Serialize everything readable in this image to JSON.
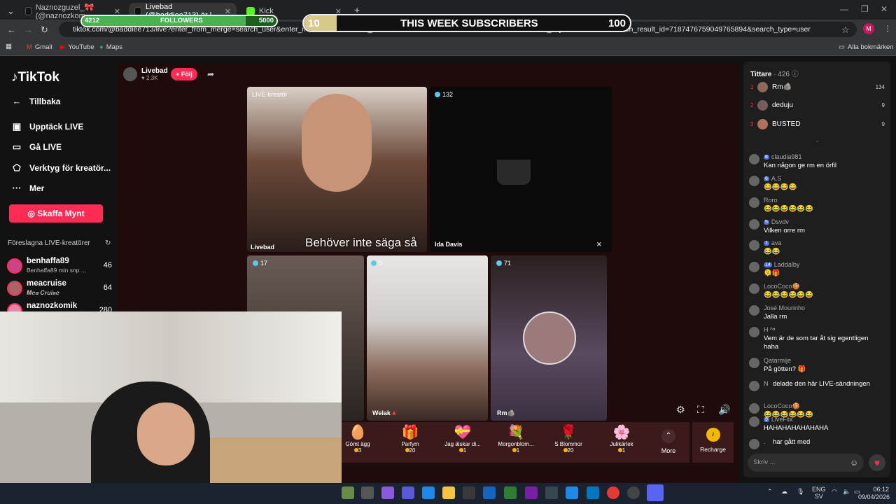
{
  "browser": {
    "tabs": [
      {
        "title": "Naznozguzel_🎀 (@naznozkom"
      },
      {
        "title": "Livebad (@baddiee713) är l"
      },
      {
        "title": "Kick"
      }
    ],
    "url": "tiktok.com/@baddiee713/live?enter_from_merge=search_user&enter_method=o",
    "url_tail": "to&search_id=20260408205018162D1891381717DA076&search_keyword=livebad&search_result_id=7187476759049765894&search_type=user",
    "profile_initial": "M",
    "bookmarks": [
      "Gmail",
      "YouTube",
      "Maps"
    ],
    "all_bookmarks": "Alla bokmärken"
  },
  "overlay": {
    "followers_current": "4212",
    "followers_label": "FOLLOWERS",
    "followers_goal": "5000",
    "followers_progress": 0.84,
    "subs_current": "10",
    "subs_label": "THIS WEEK SUBSCRIBERS",
    "subs_goal": "100",
    "subs_progress": 0.1
  },
  "sidebar": {
    "logo": "TikTok",
    "back": "Tillbaka",
    "items": [
      {
        "label": "Upptäck LIVE",
        "icon": "live-icon"
      },
      {
        "label": "Gå LIVE",
        "icon": "camera-icon"
      },
      {
        "label": "Verktyg för kreatör...",
        "icon": "tools-icon"
      },
      {
        "label": "Mer",
        "icon": "more-icon"
      }
    ],
    "coins_button": "Skaffa Mynt",
    "suggested_title": "Föreslagna LIVE-kreatörer",
    "suggested": [
      {
        "name": "benhaffa89",
        "sub": "Benhaffa89 min snp ...",
        "count": "46"
      },
      {
        "name": "meacruise",
        "sub": "𝑴𝒆𝒂 𝑪𝒓𝒖𝒊𝒔𝒆",
        "count": "64"
      },
      {
        "name": "naznozkomik",
        "sub": "",
        "count": "280"
      }
    ]
  },
  "host": {
    "name": "Livebad",
    "likes": "2.3K",
    "follow": "+ Följ"
  },
  "tiles": [
    {
      "badge": "LIVE-kreatör",
      "name": "Livebad"
    },
    {
      "badge": "132",
      "name": "Ida Davis"
    },
    {
      "badge": "17",
      "name": ""
    },
    {
      "badge": "5",
      "name": "Welak🔺"
    },
    {
      "badge": "71",
      "name": "Rm🪨"
    }
  ],
  "caption": "Behöver inte säga så",
  "gifts": [
    {
      "name": "Gömt ägg",
      "price": "3",
      "icon": "🥚"
    },
    {
      "name": "Parfym",
      "price": "20",
      "icon": "🎁"
    },
    {
      "name": "Jag älskar di...",
      "price": "1",
      "icon": "💝"
    },
    {
      "name": "Morgonblom...",
      "price": "1",
      "icon": "💐"
    },
    {
      "name": "S Blommor",
      "price": "20",
      "icon": "🌹"
    },
    {
      "name": "Julikärlek",
      "price": "1",
      "icon": "🌸"
    }
  ],
  "more_label": "More",
  "recharge_label": "Recharge",
  "viewers": {
    "title": "Tittare",
    "count": "· 426",
    "top": [
      {
        "rank": "1",
        "name": "Rm🪨",
        "score": "134"
      },
      {
        "rank": "2",
        "name": "deduju",
        "score": "9"
      },
      {
        "rank": "3",
        "name": "BUSTED",
        "score": "9"
      }
    ]
  },
  "chat": [
    {
      "user": "claudia981",
      "level": "8",
      "text": "Kan någon ge rm en örfil"
    },
    {
      "user": "A.S",
      "level": "6",
      "text": "😂😂😂😂"
    },
    {
      "user": "Roro",
      "level": "",
      "text": "😂😂😂😂😂😂"
    },
    {
      "user": "Dsvdv",
      "level": "5",
      "text": "Vilken orre rm"
    },
    {
      "user": "ava",
      "level": "1",
      "text": "😂😂"
    },
    {
      "user": "Laddalby",
      "level": "14",
      "text": "🫠🎁"
    },
    {
      "user": "LocoCoco🍪",
      "level": "",
      "text": "😂😂😂😂😂😂"
    },
    {
      "user": "José Mourinho",
      "level": "",
      "text": "Jalla rm"
    },
    {
      "user": "H ^ᵜ",
      "level": "",
      "text": "Vem är de som tar åt sig egentligen haha"
    },
    {
      "user": "Qatarmije",
      "level": "",
      "text": "På götten? 🎁"
    },
    {
      "user": "N",
      "level": "",
      "text": "delade den här LIVE-sändningen"
    },
    {
      "user": "LocoCoco🍪",
      "level": "",
      "text": "😂😂😂😂😂😂"
    },
    {
      "user": "LiveFlix",
      "level": "9",
      "text": "HAHAHAHAHAHAHA"
    },
    {
      "user": ".",
      "level": "",
      "text": "har gått med"
    }
  ],
  "chat_placeholder": "Skriv ...",
  "taskbar": {
    "lang": "ENG",
    "region": "SV",
    "time": "06:12",
    "date": "09/04/2026"
  }
}
